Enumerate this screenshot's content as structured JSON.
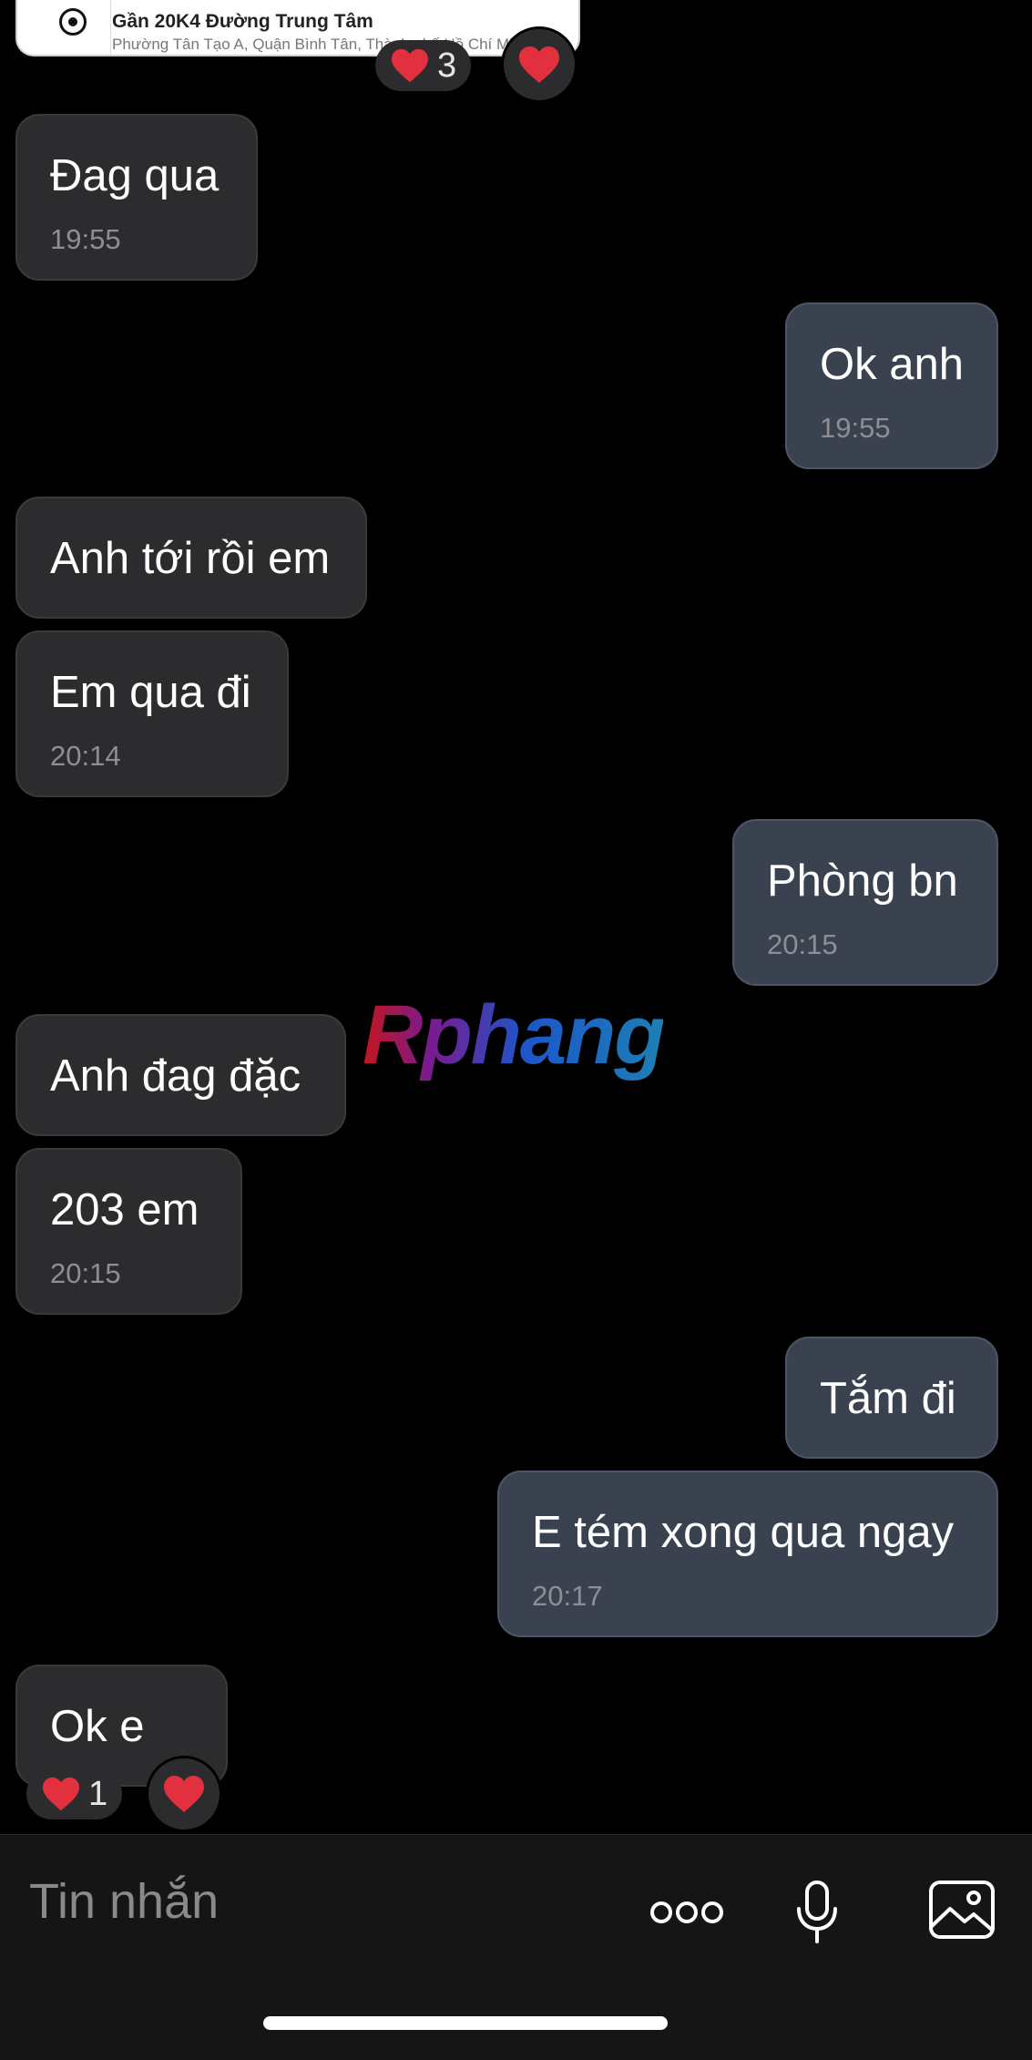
{
  "location_card": {
    "title": "Gần 20K4 Đường Trung Tâm",
    "subtitle": "Phường Tân Tạo A, Quận Bình Tân, Thành phố Hồ Chí Minh"
  },
  "top_reaction": {
    "count": "3"
  },
  "messages": [
    {
      "text": "Đag qua",
      "time": "19:55"
    },
    {
      "text": "Ok anh",
      "time": "19:55"
    },
    {
      "text": "Anh tới rồi em"
    },
    {
      "text": "Em qua đi",
      "time": "20:14"
    },
    {
      "text": "Phòng bn",
      "time": "20:15"
    },
    {
      "text": "Anh đag đặc"
    },
    {
      "text": "203 em",
      "time": "20:15"
    },
    {
      "text": "Tắm đi"
    },
    {
      "text": "E tém xong qua ngay",
      "time": "20:17"
    },
    {
      "text": "Ok e"
    }
  ],
  "bottom_reaction": {
    "count": "1"
  },
  "watermark": "Rphang",
  "composer": {
    "placeholder": "Tin nhắn"
  },
  "colors": {
    "background": "#000000",
    "incoming_bubble": "#2c2c2e",
    "outgoing_bubble": "#3a4250",
    "heart": "#e3303f"
  },
  "icons": [
    "heart-icon",
    "more-icon",
    "microphone-icon",
    "image-icon"
  ]
}
